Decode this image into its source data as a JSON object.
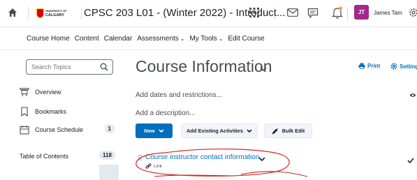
{
  "header": {
    "course_title": "CPSC 203 L01 - (Winter 2022) - Introduct...",
    "logo_line1": "UNIVERSITY OF",
    "logo_line2": "CALGARY",
    "user_initials": "JT",
    "user_name": "James Tam"
  },
  "nav": {
    "items": [
      "Course Home",
      "Content",
      "Calendar",
      "Assessments",
      "My Tools",
      "Edit Course"
    ]
  },
  "sidebar": {
    "search_placeholder": "Search Topics",
    "items": [
      {
        "label": "Overview",
        "icon": "overview-icon"
      },
      {
        "label": "Bookmarks",
        "icon": "bookmark-icon"
      },
      {
        "label": "Course Schedule",
        "icon": "calendar-icon",
        "count": "1"
      }
    ],
    "toc_label": "Table of Contents",
    "toc_count": "118"
  },
  "main": {
    "title": "Course Information",
    "print_label": "Print",
    "settings_label": "Settings",
    "add_dates": "Add dates and restrictions...",
    "add_description": "Add a description...",
    "buttons": {
      "new": "New",
      "add_existing": "Add Existing Activities",
      "bulk_edit": "Bulk Edit"
    },
    "topic": {
      "title": "Course instructor contact information",
      "type": "Link"
    }
  },
  "colors": {
    "accent": "#006fbf",
    "avatar": "#a3288a",
    "annotation": "#d8231f"
  }
}
